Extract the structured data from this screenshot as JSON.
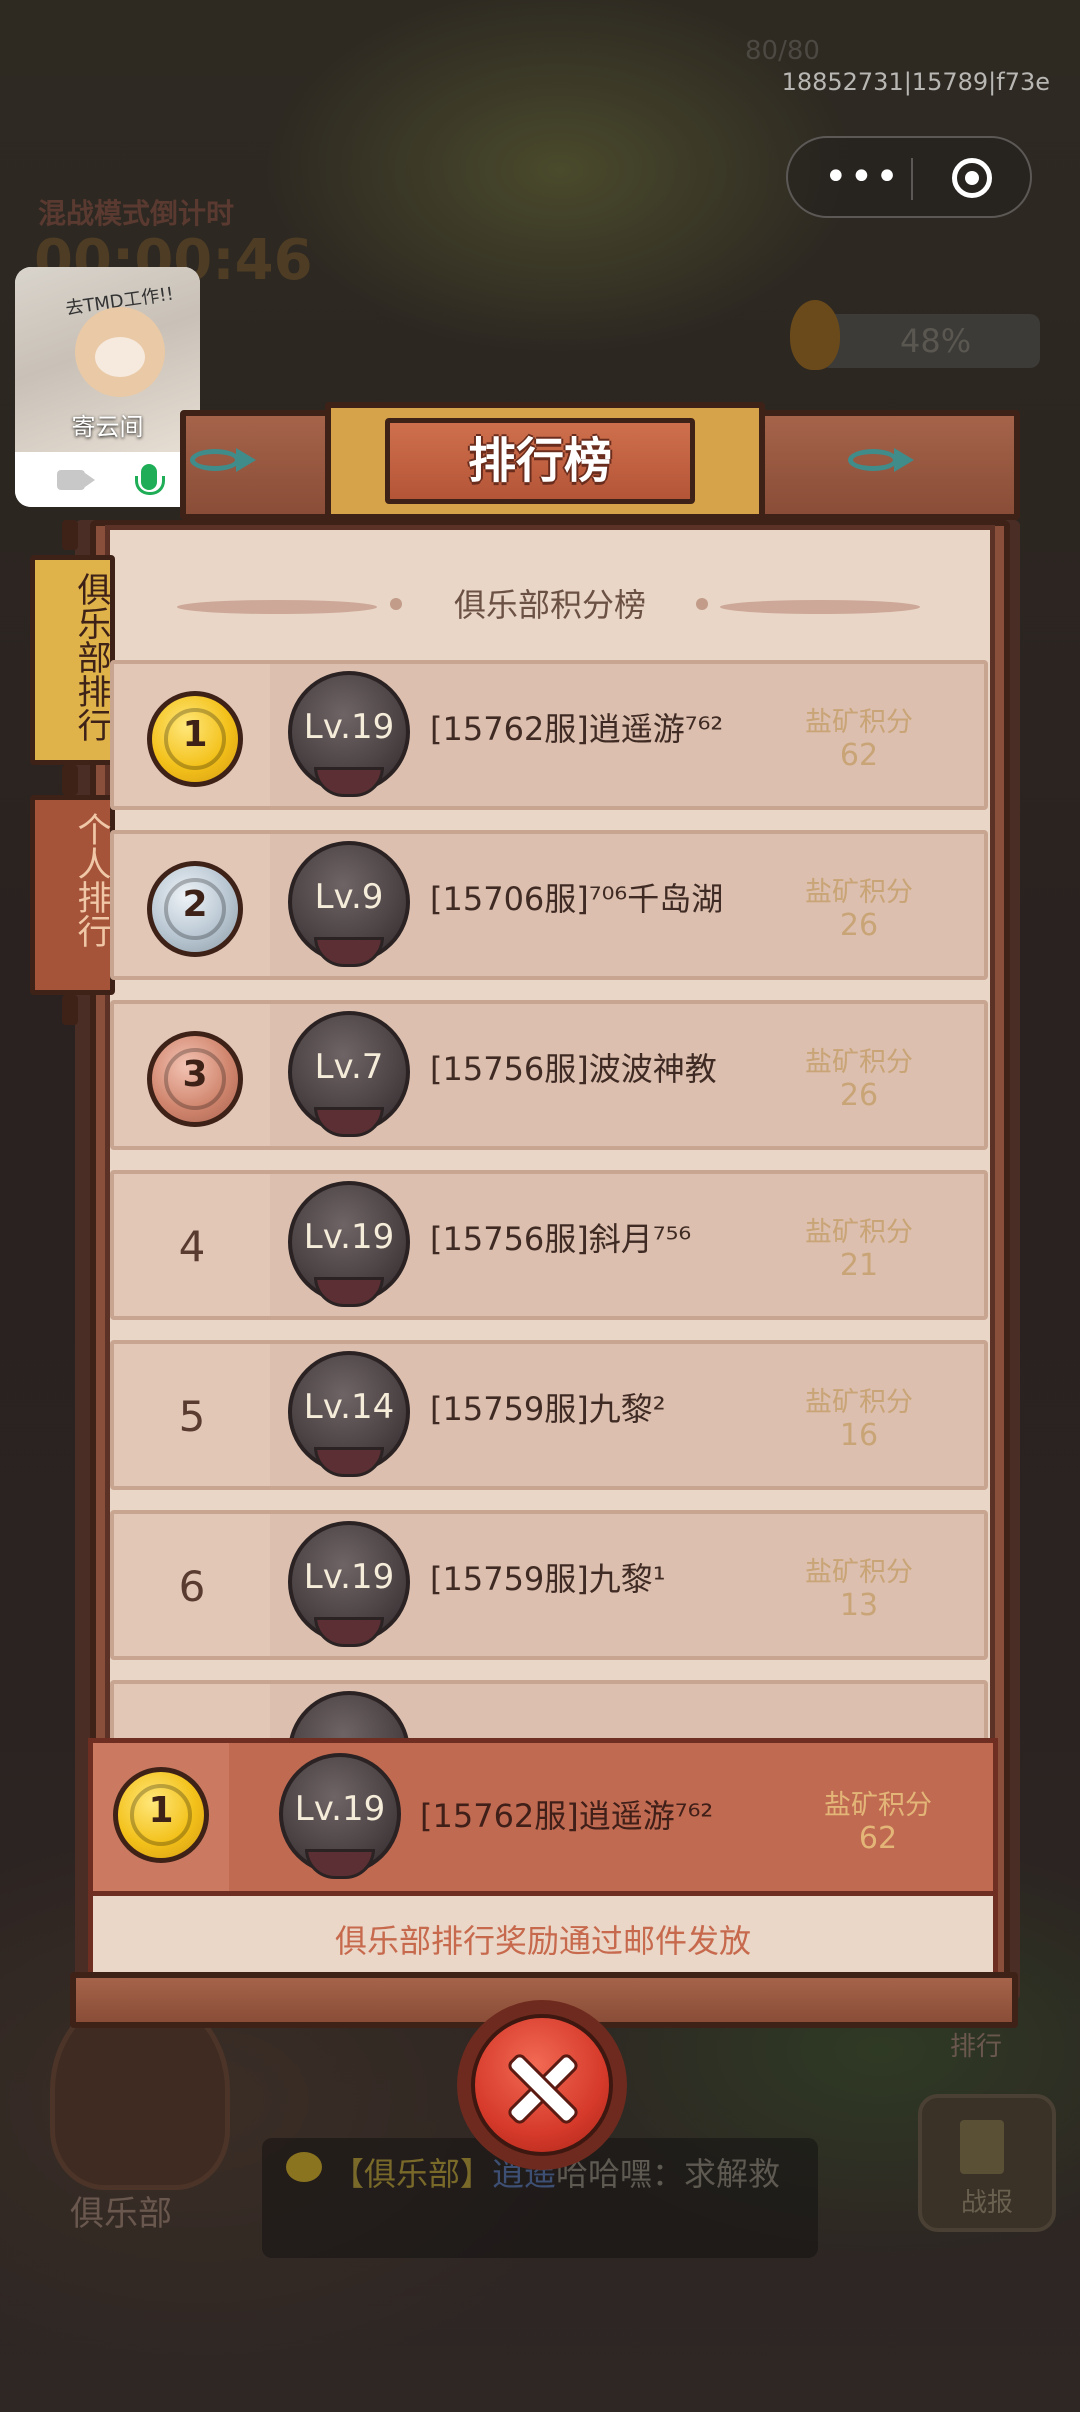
{
  "session_id": "18852731|15789|f73e",
  "background": {
    "countdown_label": "混战模式倒计时",
    "countdown_value": "00:00:46",
    "hp_text": "80/80",
    "progress_percent": "48%",
    "club_label": "俱乐部",
    "rank_label": "排行",
    "report_label": "战报",
    "chat_channel": "【俱乐部】",
    "chat_sender": "逍遥",
    "chat_message": "哈哈嘿：求解救"
  },
  "floating_window": {
    "name": "寄云间",
    "badge": "去TMD工作!!"
  },
  "panel": {
    "title": "排行榜",
    "subtitle": "俱乐部积分榜",
    "tabs": [
      {
        "label": "俱乐部排行",
        "active": true
      },
      {
        "label": "个人排行",
        "active": false
      }
    ],
    "score_label": "盐矿积分",
    "rows": [
      {
        "rank": "1",
        "medal": "gold",
        "level": "Lv.19",
        "name": "[15762服]逍遥游⁷⁶²",
        "score": "62"
      },
      {
        "rank": "2",
        "medal": "silver",
        "level": "Lv.9",
        "name": "[15706服]⁷⁰⁶千岛湖",
        "score": "26"
      },
      {
        "rank": "3",
        "medal": "bronze",
        "level": "Lv.7",
        "name": "[15756服]波波神教",
        "score": "26"
      },
      {
        "rank": "4",
        "medal": "",
        "level": "Lv.19",
        "name": "[15756服]斜月⁷⁵⁶",
        "score": "21"
      },
      {
        "rank": "5",
        "medal": "",
        "level": "Lv.14",
        "name": "[15759服]九黎²",
        "score": "16"
      },
      {
        "rank": "6",
        "medal": "",
        "level": "Lv.19",
        "name": "[15759服]九黎¹",
        "score": "13"
      }
    ],
    "self_row": {
      "rank": "1",
      "medal": "gold",
      "level": "Lv.19",
      "name": "[15762服]逍遥游⁷⁶²",
      "score": "62"
    },
    "footnote": "俱乐部排行奖励通过邮件发放"
  }
}
